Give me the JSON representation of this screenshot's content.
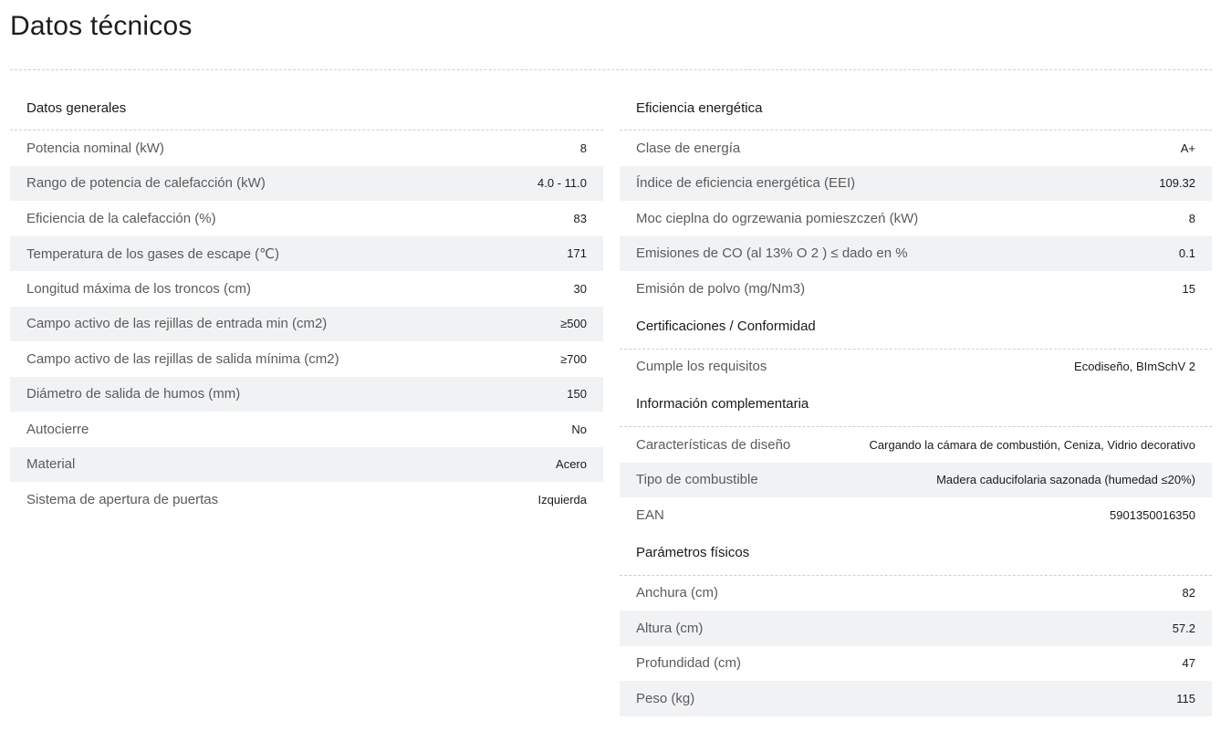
{
  "page_title": "Datos técnicos",
  "left_sections": [
    {
      "title": "Datos generales",
      "rows": [
        {
          "label": "Potencia nominal (kW)",
          "value": "8"
        },
        {
          "label": "Rango de potencia de calefacción (kW)",
          "value": "4.0 - 11.0"
        },
        {
          "label": "Eficiencia de la calefacción (%)",
          "value": "83"
        },
        {
          "label": "Temperatura de los gases de escape (℃)",
          "value": "171"
        },
        {
          "label": "Longitud máxima de los troncos (cm)",
          "value": "30"
        },
        {
          "label": "Campo activo de las rejillas de entrada min (cm2)",
          "value": "≥500"
        },
        {
          "label": "Campo activo de las rejillas de salida mínima (cm2)",
          "value": "≥700"
        },
        {
          "label": "Diámetro de salida de humos (mm)",
          "value": "150"
        },
        {
          "label": "Autocierre",
          "value": "No"
        },
        {
          "label": "Material",
          "value": "Acero"
        },
        {
          "label": "Sistema de apertura de puertas",
          "value": "Izquierda"
        }
      ]
    }
  ],
  "right_sections": [
    {
      "title": "Eficiencia energética",
      "rows": [
        {
          "label": "Clase de energía",
          "value": "A+"
        },
        {
          "label": "Índice de eficiencia energética (EEI)",
          "value": "109.32"
        },
        {
          "label": "Moc cieplna do ogrzewania pomieszczeń (kW)",
          "value": "8"
        },
        {
          "label": "Emisiones de CO (al 13% O 2 ) ≤ dado en %",
          "value": "0.1"
        },
        {
          "label": "Emisión de polvo (mg/Nm3)",
          "value": "15"
        }
      ]
    },
    {
      "title": "Certificaciones / Conformidad",
      "rows": [
        {
          "label": "Cumple los requisitos",
          "value": "Ecodiseño, BImSchV 2"
        }
      ]
    },
    {
      "title": "Información complementaria",
      "rows": [
        {
          "label": "Características de diseño",
          "value": "Cargando la cámara de combustión, Ceniza, Vidrio decorativo"
        },
        {
          "label": "Tipo de combustible",
          "value": "Madera caducifolaria sazonada (humedad ≤20%)"
        },
        {
          "label": "EAN",
          "value": "5901350016350"
        }
      ]
    },
    {
      "title": "Parámetros físicos",
      "rows": [
        {
          "label": "Anchura (cm)",
          "value": "82"
        },
        {
          "label": "Altura (cm)",
          "value": "57.2"
        },
        {
          "label": "Profundidad (cm)",
          "value": "47"
        },
        {
          "label": "Peso (kg)",
          "value": "115"
        }
      ]
    }
  ],
  "colors": {
    "alt_row_bg": "#f1f2f4",
    "divider": "#cfcfcf",
    "label_text": "#5b5b5b",
    "value_text": "#1a1a1a"
  }
}
